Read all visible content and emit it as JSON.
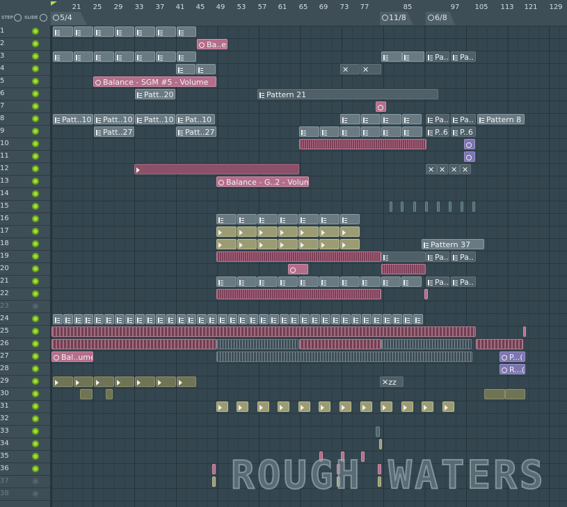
{
  "header": {
    "step_label": "STEP",
    "slide_label": "SLIDE"
  },
  "timeline": {
    "bar_numbers": [
      "21",
      "25",
      "29",
      "33",
      "37",
      "41",
      "45",
      "49",
      "53",
      "57",
      "61",
      "65",
      "69",
      "73",
      "77",
      "85",
      "97",
      "105",
      "113",
      "121",
      "129"
    ],
    "markers": [
      {
        "label": "5/4",
        "icon": "time-signature-marker-icon"
      },
      {
        "label": "11/8",
        "icon": "time-signature-marker-icon"
      },
      {
        "label": "6/8",
        "icon": "time-signature-marker-icon"
      }
    ]
  },
  "tracks": [
    {
      "num": "1"
    },
    {
      "num": "2"
    },
    {
      "num": "3"
    },
    {
      "num": "4"
    },
    {
      "num": "5"
    },
    {
      "num": "6"
    },
    {
      "num": "7"
    },
    {
      "num": "8"
    },
    {
      "num": "9"
    },
    {
      "num": "10"
    },
    {
      "num": "11"
    },
    {
      "num": "12"
    },
    {
      "num": "13"
    },
    {
      "num": "14"
    },
    {
      "num": "15"
    },
    {
      "num": "16"
    },
    {
      "num": "17"
    },
    {
      "num": "18"
    },
    {
      "num": "19"
    },
    {
      "num": "20"
    },
    {
      "num": "21"
    },
    {
      "num": "22"
    },
    {
      "num": "23",
      "muted": true
    },
    {
      "num": "24"
    },
    {
      "num": "25"
    },
    {
      "num": "26"
    },
    {
      "num": "27"
    },
    {
      "num": "28"
    },
    {
      "num": "29"
    },
    {
      "num": "30"
    },
    {
      "num": "31"
    },
    {
      "num": "32"
    },
    {
      "num": "33"
    },
    {
      "num": "34"
    },
    {
      "num": "35"
    },
    {
      "num": "36"
    },
    {
      "num": "37",
      "muted": true
    },
    {
      "num": "38",
      "muted": true
    }
  ],
  "clip_labels": {
    "balance_e": "Ba..e",
    "balance_sgm": "Balance - SGM #5 - Volume",
    "patt_20": "Patt..20",
    "pattern_21": "Pattern 21",
    "patt_10": "Patt..10",
    "pat_10": "Pat..10",
    "patt_27": "Patt..27",
    "pattern_8": "Pattern 8",
    "pa_short": "Pa..",
    "p_6": "P..6",
    "balance_g2": "Balance - G..2 - Volume",
    "pattern_37": "Pattern 37",
    "bal_ume": "Bal..ume",
    "p_short": "P...(",
    "r_short": "R...(",
    "xzz": "zz"
  },
  "watermark": "ROUGH WATERS",
  "colors": {
    "pattern_clip": "#6a7a83",
    "audio_clip": "#b46e8a",
    "automation_clip": "#b46e8a",
    "olive_clip": "#9c9c74",
    "purple_clip": "#7d75b0",
    "led_active": "#a4dc3a",
    "background": "#34454f"
  }
}
